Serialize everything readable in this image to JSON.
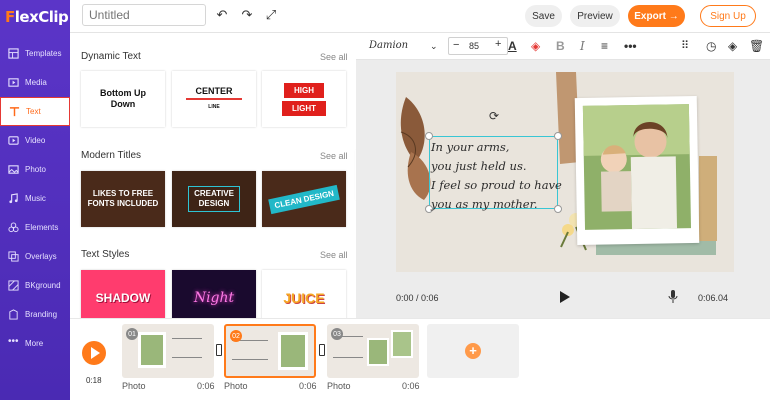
{
  "app": {
    "logo_prefix": "F",
    "logo_rest": "lexClip"
  },
  "sidebar": {
    "items": [
      {
        "label": "Templates",
        "icon": "template-icon"
      },
      {
        "label": "Media",
        "icon": "media-icon"
      },
      {
        "label": "Text",
        "icon": "text-icon",
        "active": true
      },
      {
        "label": "Video",
        "icon": "video-icon"
      },
      {
        "label": "Photo",
        "icon": "photo-icon"
      },
      {
        "label": "Music",
        "icon": "music-icon"
      },
      {
        "label": "Elements",
        "icon": "elements-icon"
      },
      {
        "label": "Overlays",
        "icon": "overlays-icon"
      },
      {
        "label": "BKground",
        "icon": "background-icon"
      },
      {
        "label": "Branding",
        "icon": "branding-icon"
      },
      {
        "label": "More",
        "icon": "more-icon"
      }
    ]
  },
  "topbar": {
    "title_placeholder": "Untitled",
    "save": "Save",
    "preview": "Preview",
    "export": "Export →",
    "signup": "Sign Up"
  },
  "panel": {
    "sections": [
      {
        "title": "Dynamic Text",
        "see_all": "See all"
      },
      {
        "title": "Modern Titles",
        "see_all": "See all"
      },
      {
        "title": "Text Styles",
        "see_all": "See all"
      }
    ],
    "dynamic_cards": [
      {
        "line1": "Bottom Up",
        "line2": "Down"
      },
      {
        "line1": "CENTER",
        "line2": "LINE"
      },
      {
        "line1": "HIGH",
        "line2": "LIGHT"
      }
    ],
    "modern_cards": [
      {
        "line1": "LIKES TO FREE",
        "line2": "FONTS INCLUDED"
      },
      {
        "line1": "CREATIVE",
        "line2": "DESIGN"
      },
      {
        "line1": "CLEAN DESIGN",
        "line2": ""
      }
    ],
    "style_cards": [
      "SHADOW",
      "Night",
      "JUICE"
    ]
  },
  "editor_toolbar": {
    "font": "Damion",
    "font_size": "85"
  },
  "canvas": {
    "text_lines": [
      "In your arms,",
      "you just held us.",
      "I feel so proud to have",
      "you as my mother."
    ]
  },
  "playback": {
    "current": "0:00 / 0:06",
    "duration": "0:06.04"
  },
  "timeline": {
    "total": "0:18",
    "clips": [
      {
        "num": "01",
        "label": "Photo",
        "duration": "0:06"
      },
      {
        "num": "02",
        "label": "Photo",
        "duration": "0:06"
      },
      {
        "num": "03",
        "label": "Photo",
        "duration": "0:06"
      }
    ]
  },
  "colors": {
    "accent": "#ff7a1a",
    "sidebar": "#5b35c8",
    "selection": "#39c6d4"
  }
}
